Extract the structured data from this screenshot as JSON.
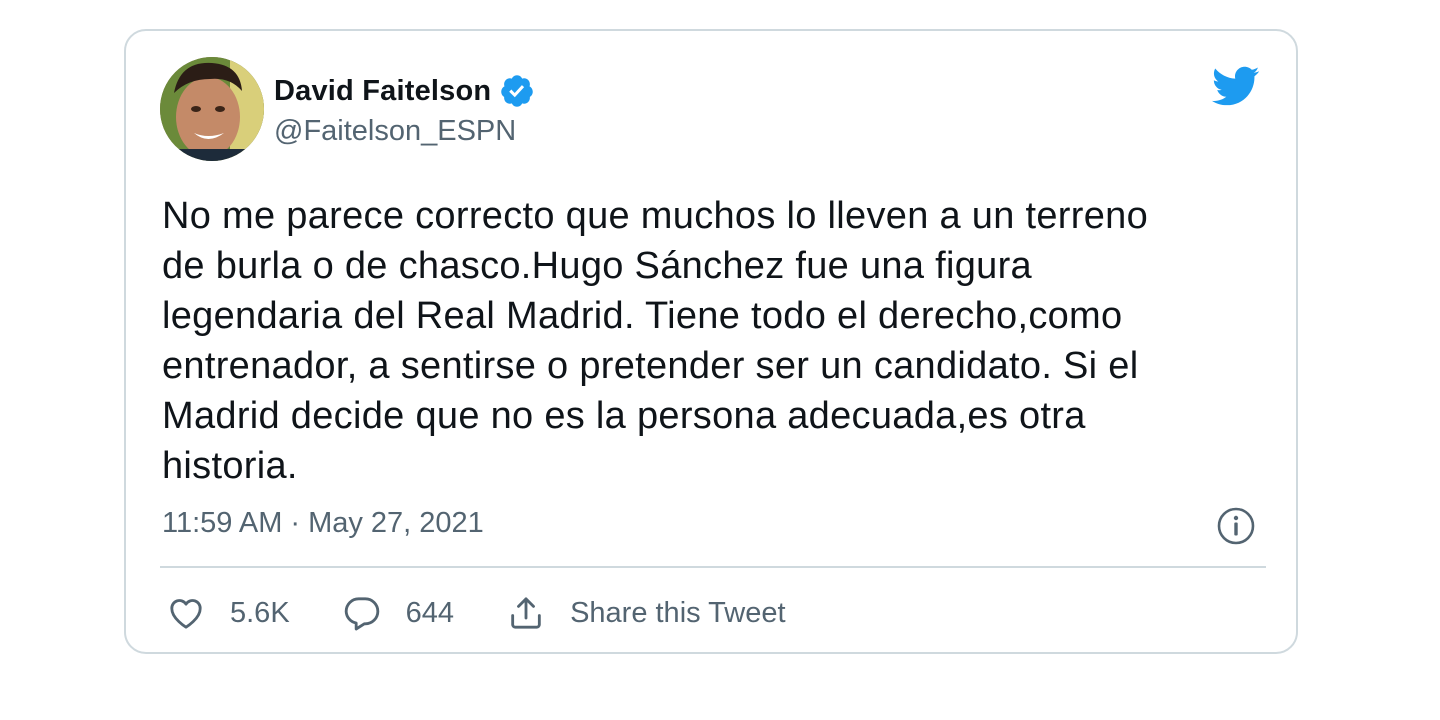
{
  "tweet": {
    "author": {
      "display_name": "David Faitelson",
      "handle": "@Faitelson_ESPN",
      "verified": true,
      "avatar_icon": "avatar-photo"
    },
    "text": "No me parece correcto que muchos lo lleven a un terreno\nde burla o de chasco.Hugo Sánchez fue una figura\nlegendaria del Real Madrid. Tiene todo el derecho,como\nentrenador, a sentirse o pretender ser un candidato. Si el\nMadrid decide que no es la persona adecuada,es otra\nhistoria.",
    "time": "11:59 AM",
    "separator": "·",
    "date": "May 27, 2021"
  },
  "actions": {
    "likes": {
      "icon": "heart-icon",
      "count": "5.6K"
    },
    "replies": {
      "icon": "reply-bubble-icon",
      "count": "644"
    },
    "share": {
      "icon": "share-icon",
      "label": "Share this Tweet"
    }
  },
  "icons": {
    "brand": "twitter-bird-icon",
    "verified": "verified-badge-icon",
    "info": "info-icon"
  },
  "colors": {
    "brand_blue": "#1d9bf0",
    "text_primary": "#0f1419",
    "text_secondary": "#536471",
    "border": "#cfd9de"
  }
}
